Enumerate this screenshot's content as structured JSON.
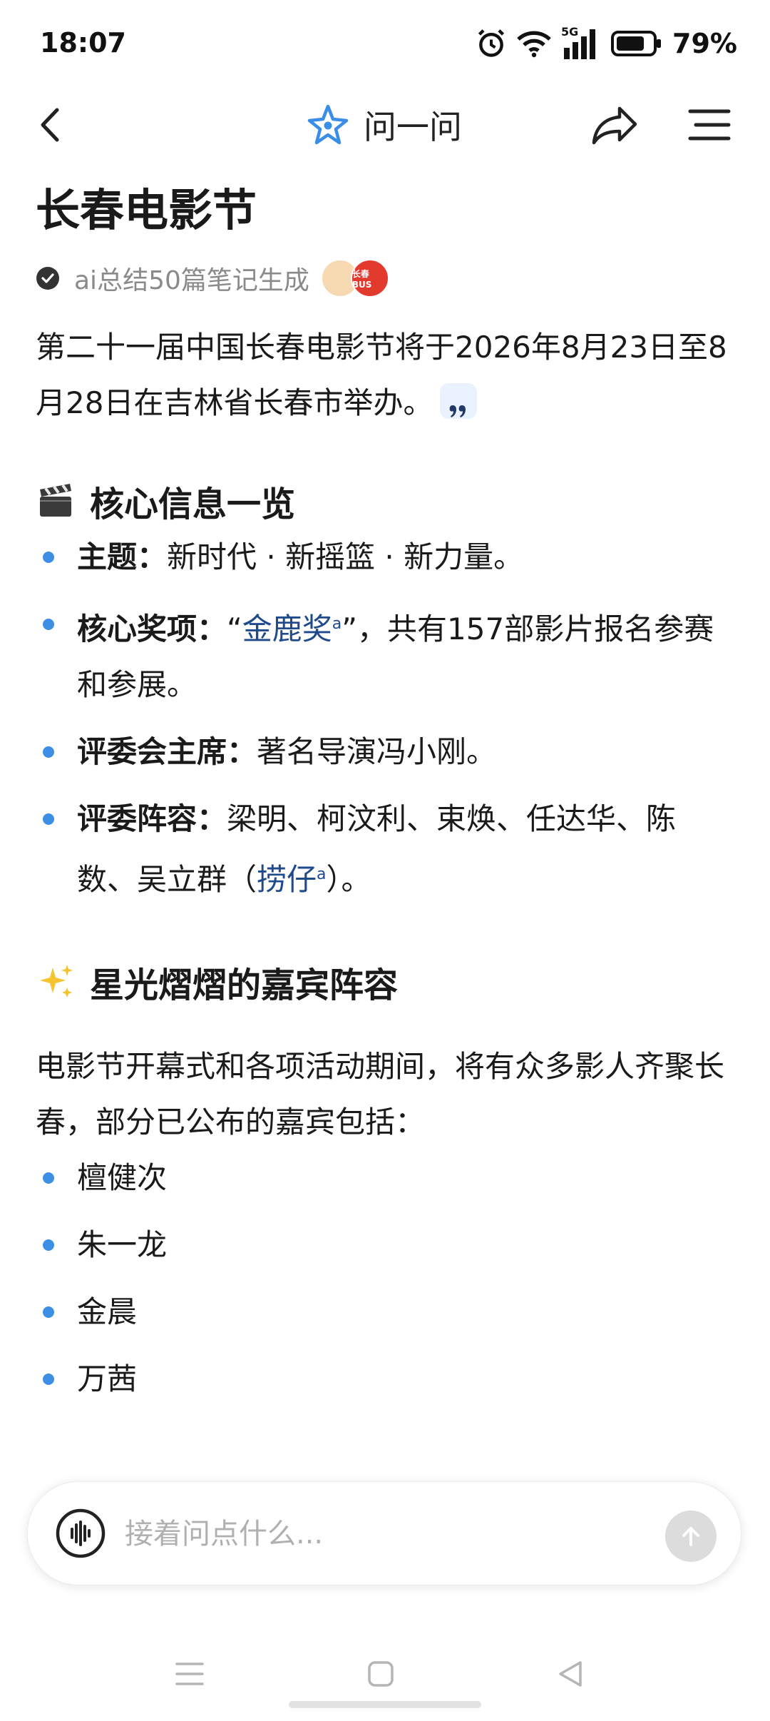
{
  "status_bar": {
    "time": "18:07",
    "network": "5G",
    "battery": "79%"
  },
  "nav": {
    "title": "问一问"
  },
  "page": {
    "title": "长春电影节",
    "meta": "ai总结50篇笔记生成",
    "avatar2_text": "长春BUS",
    "intro": "第二十一届中国长春电影节将于2026年8月23日至8月28日在吉林省长春市举办。"
  },
  "section1": {
    "heading": "核心信息一览",
    "items": [
      {
        "label": "主题：",
        "text": "新时代 · 新摇篮 · 新力量。"
      },
      {
        "label": "核心奖项：",
        "pre": "“",
        "link": "金鹿奖",
        "post": "”，共有157部影片报名参赛和参展。"
      },
      {
        "label": "评委会主席：",
        "text": "著名导演冯小刚。"
      },
      {
        "label": "评委阵容：",
        "pre": "梁明、柯汶利、束焕、任达华、陈数、吴立群（",
        "link": "捞仔",
        "post": "）。"
      }
    ]
  },
  "section2": {
    "heading": "星光熠熠的嘉宾阵容",
    "text": "电影节开幕式和各项活动期间，将有众多影人齐聚长春，部分已公布的嘉宾包括：",
    "guests": [
      "檀健次",
      "朱一龙",
      "金晨",
      "万茜"
    ]
  },
  "input": {
    "placeholder": "接着问点什么..."
  },
  "colors": {
    "accent": "#3d8fe6",
    "link": "#1f4a8c",
    "text": "#1a1a1a",
    "muted": "#8a8a8a"
  },
  "icons": {
    "nav": [
      "back-icon",
      "ai-star-icon",
      "share-icon",
      "menu-icon"
    ],
    "input": [
      "voice-icon",
      "send-arrow-icon"
    ],
    "system": [
      "recent-apps-icon",
      "home-icon",
      "back-triangle-icon"
    ]
  }
}
